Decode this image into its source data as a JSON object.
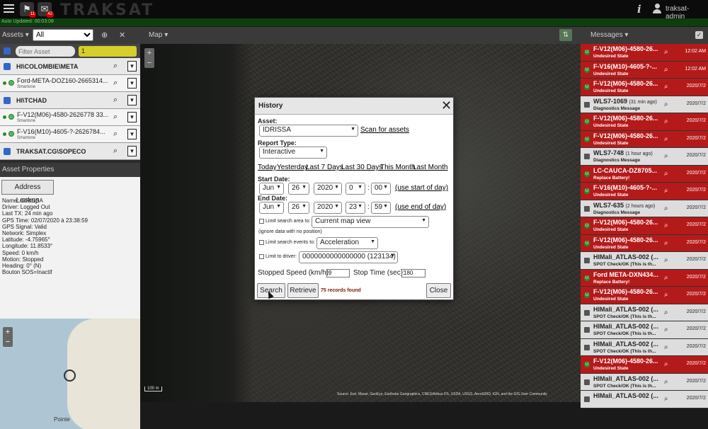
{
  "topbar": {
    "logo_text": "TRAKSAT",
    "alerts_badge": "11",
    "messages_badge": "42",
    "info_glyph": "i",
    "username": "traksat-admin"
  },
  "auto_updated": "Auto Updated: 00:03:08",
  "assets_panel": {
    "title": "Assets ▾",
    "filter_value": "All",
    "filter_placeholder": "Filter Asset",
    "count": "1",
    "rows": [
      {
        "type": "group",
        "name": "HI\\COLOMBIE\\META"
      },
      {
        "type": "asset",
        "name": "Ford-META-DOZ160-2665314...",
        "sub": "Smartone"
      },
      {
        "type": "group",
        "name": "HI\\TCHAD"
      },
      {
        "type": "asset",
        "name": "F-V12(M06)-4580-2626778 33...",
        "sub": "Smartone"
      },
      {
        "type": "asset",
        "name": "F-V16(M10)-4605-?-2626784...",
        "sub": "Smartone"
      },
      {
        "type": "group",
        "name": "TRAKSAT.CG\\SOPECO"
      }
    ]
  },
  "asset_properties": {
    "title": "Asset Properties",
    "address_lookup": "Address Lookup",
    "lines": [
      "Name: IDRISSA",
      "Driver: Logged Out",
      "Last TX: 24 min ago",
      "GPS Time: 02/07/2020 à 23:38:59",
      "GPS Signal: Valid",
      "Network: Simplex",
      "Latitude: -4.75965°",
      "Longitude: 11.8533°",
      "Speed: 0 km/h",
      "Motion: Stopped",
      "Heading: 0° (N)",
      "Bouton SOS=Inactif"
    ]
  },
  "minimap": {
    "place": "Pointe"
  },
  "map": {
    "title": "Map ▾",
    "scale": "100 m",
    "attribution": "Source: Esri, Maxar, GeoEye, Earthstar Geographics, CNES/Airbus DS, USDA, USGS, AeroGRID, IGN, and the GIS User Community"
  },
  "messages_panel": {
    "title": "Messages ▾",
    "items": [
      {
        "color": "red",
        "title": "F-V12(M06)-4580-26...",
        "sub": "Undesired State",
        "time": "12:02 AM"
      },
      {
        "color": "red",
        "title": "F-V16(M10)-4605-?-...",
        "sub": "Undesired State",
        "time": "12:02 AM"
      },
      {
        "color": "red",
        "title": "F-V12(M06)-4580-26...",
        "sub": "Undesired State",
        "time": "2020/7/2"
      },
      {
        "color": "gray",
        "title": "WLS7-1069",
        "ago": "(31 min ago)",
        "sub": "Diagnostics Message",
        "time": "2020/7/2"
      },
      {
        "color": "red",
        "title": "F-V12(M06)-4580-26...",
        "sub": "Undesired State",
        "time": "2020/7/2"
      },
      {
        "color": "red",
        "title": "F-V12(M06)-4580-26...",
        "sub": "Undesired State",
        "time": "2020/7/2"
      },
      {
        "color": "gray",
        "title": "WLS7-748",
        "ago": "(1 hour ago)",
        "sub": "Diagnostics Message",
        "time": "2020/7/2"
      },
      {
        "color": "red",
        "title": "LC-CAUCA-DZ8705...",
        "sub": "Replace Battery!",
        "time": "2020/7/2"
      },
      {
        "color": "red",
        "title": "F-V16(M10)-4605-?-...",
        "sub": "Undesired State",
        "time": "2020/7/2"
      },
      {
        "color": "gray",
        "title": "WLS7-635",
        "ago": "(2 hours ago)",
        "sub": "Diagnostics Message",
        "time": "2020/7/2"
      },
      {
        "color": "red",
        "title": "F-V12(M06)-4580-26...",
        "sub": "Undesired State",
        "time": "2020/7/2"
      },
      {
        "color": "red",
        "title": "F-V12(M06)-4580-26...",
        "sub": "Undesired State",
        "time": "2020/7/2"
      },
      {
        "color": "gray",
        "title": "HIMali_ATLAS-002 (...",
        "sub": "SPOT Check/OK (This is th...",
        "time": "2020/7/2"
      },
      {
        "color": "red",
        "title": "Ford META-DXN434...",
        "sub": "Replace Battery!",
        "time": "2020/7/2"
      },
      {
        "color": "red",
        "title": "F-V12(M06)-4580-26...",
        "sub": "Undesired State",
        "time": "2020/7/2"
      },
      {
        "color": "gray",
        "title": "HIMali_ATLAS-002 (...",
        "sub": "SPOT Check/OK (This is th...",
        "time": "2020/7/2"
      },
      {
        "color": "gray",
        "title": "HIMali_ATLAS-002 (...",
        "sub": "SPOT Check/OK (This is th...",
        "time": "2020/7/2"
      },
      {
        "color": "gray",
        "title": "HIMali_ATLAS-002 (...",
        "sub": "SPOT Check/OK (This is th...",
        "time": "2020/7/2"
      },
      {
        "color": "red",
        "title": "F-V12(M06)-4580-26...",
        "sub": "Undesired State",
        "time": "2020/7/2"
      },
      {
        "color": "gray",
        "title": "HIMali_ATLAS-002 (...",
        "sub": "SPOT Check/OK (This is th...",
        "time": "2020/7/2"
      },
      {
        "color": "gray",
        "title": "HIMali_ATLAS-002 (...",
        "sub": "",
        "time": "2020/7/2"
      }
    ]
  },
  "history": {
    "title": "History",
    "asset_label": "Asset:",
    "asset_value": "IDRISSA",
    "scan_link": "Scan for assets",
    "report_type_label": "Report Type:",
    "report_type_value": "Interactive",
    "quick_links": [
      "Today",
      "Yesterday",
      "Last 7 Days",
      "Last 30 Days",
      "This Month",
      "Last Month"
    ],
    "start_label": "Start Date:",
    "start": {
      "month": "Jun",
      "day": "26",
      "year": "2020",
      "hour": "0",
      "minute": "00"
    },
    "start_link": "(use start of day)",
    "end_label": "End Date:",
    "end": {
      "month": "Jun",
      "day": "26",
      "year": "2020",
      "hour": "23",
      "minute": "59"
    },
    "end_link": "(use end of day)",
    "limit_area_label": "Limit search area to:",
    "limit_area_value": "Current map view",
    "ignore_note": "(ignore data with no position)",
    "limit_events_label": "Limit search events to:",
    "limit_events_value": "Acceleration",
    "limit_driver_label": "Limit to driver:",
    "limit_driver_value": "0000000000000000 (123134)",
    "stopped_speed_label": "Stopped Speed (km/h):",
    "stopped_speed_value": "9",
    "stop_time_label": "Stop Time (sec):",
    "stop_time_value": "180",
    "search_label": "Search",
    "retrieve_label": "Retrieve",
    "records_found": "75 records found",
    "close_label": "Close"
  }
}
